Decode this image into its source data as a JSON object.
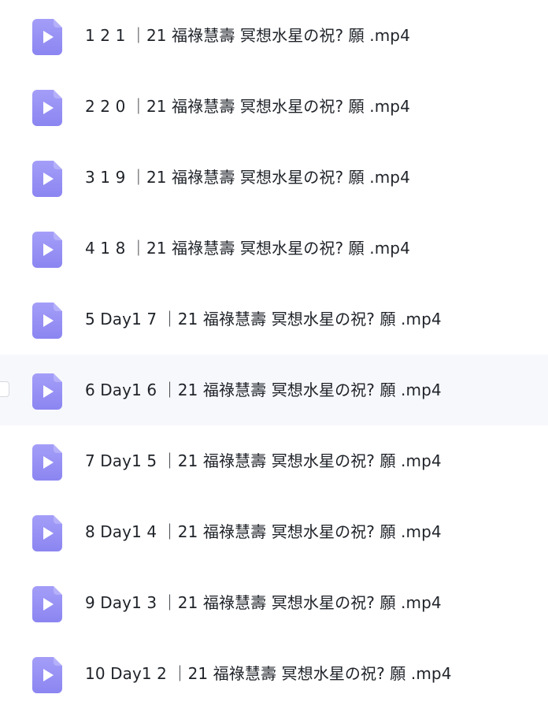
{
  "file_list": {
    "rows": [
      {
        "name": "1 2 1 ｜21 福祿慧壽 冥想水星の祝? 願 .mp4",
        "icon": "video-file-icon",
        "selected": false
      },
      {
        "name": "2 2 0 ｜21 福祿慧壽 冥想水星の祝? 願 .mp4",
        "icon": "video-file-icon",
        "selected": false
      },
      {
        "name": "3 1 9 ｜21 福祿慧壽 冥想水星の祝? 願 .mp4",
        "icon": "video-file-icon",
        "selected": false
      },
      {
        "name": "4 1 8 ｜21 福祿慧壽 冥想水星の祝? 願 .mp4",
        "icon": "video-file-icon",
        "selected": false
      },
      {
        "name": "5 Day1 7 ｜21 福祿慧壽 冥想水星の祝? 願 .mp4",
        "icon": "video-file-icon",
        "selected": false
      },
      {
        "name": "6 Day1 6 ｜21 福祿慧壽 冥想水星の祝? 願 .mp4",
        "icon": "video-file-icon",
        "selected": false
      },
      {
        "name": "7 Day1 5 ｜21 福祿慧壽 冥想水星の祝? 願 .mp4",
        "icon": "video-file-icon",
        "selected": false
      },
      {
        "name": "8 Day1 4 ｜21 福祿慧壽 冥想水星の祝? 願 .mp4",
        "icon": "video-file-icon",
        "selected": false
      },
      {
        "name": "9 Day1 3 ｜21 福祿慧壽 冥想水星の祝? 願 .mp4",
        "icon": "video-file-icon",
        "selected": false
      },
      {
        "name": "10 Day1 2 ｜21 福祿慧壽 冥想水星の祝? 願 .mp4",
        "icon": "video-file-icon",
        "selected": false
      }
    ]
  },
  "colors": {
    "icon_top": "#a29af7",
    "icon_bottom": "#8c86f2",
    "text": "#1f2329",
    "hover_row": "#f7f8fc"
  }
}
